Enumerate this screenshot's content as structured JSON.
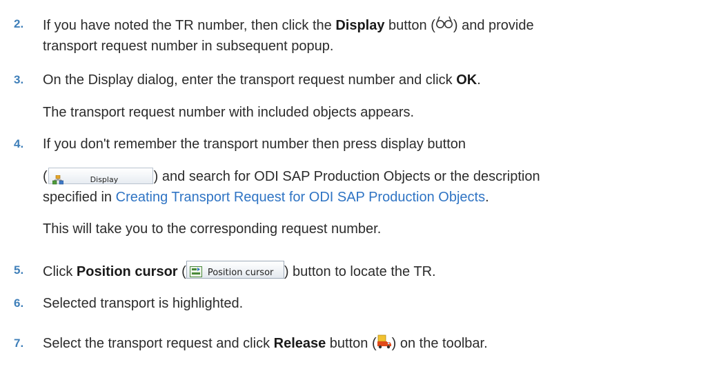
{
  "steps": {
    "s2": {
      "num": "2.",
      "pre": "If you have noted the TR number, then click the ",
      "bold": "Display",
      "mid": " button (",
      "post": ") and provide",
      "line2": "transport request number in subsequent popup."
    },
    "s3": {
      "num": "3.",
      "pre": "On the Display dialog, enter the transport request number and click ",
      "bold": "OK",
      "post": ".",
      "para": "The transport request number with included objects appears."
    },
    "s4": {
      "num": "4.",
      "line1": "If you don't remember the transport number then press display button",
      "open": "(",
      "button_label": "Display",
      "post": ") and search for ODI SAP Production Objects or the description",
      "pre3": "specified in ",
      "link": "Creating Transport Request for ODI SAP Production Objects",
      "post3": ".",
      "para": "This will take you to the corresponding request number."
    },
    "s5": {
      "num": "5.",
      "pre": "Click ",
      "bold": "Position cursor",
      "mid": " (",
      "button_label": "Position cursor",
      "post": ") button to locate the TR."
    },
    "s6": {
      "num": "6.",
      "text": "Selected transport is highlighted."
    },
    "s7": {
      "num": "7.",
      "pre": "Select the transport request and click ",
      "bold": "Release",
      "mid": " button (",
      "post": ") on the toolbar."
    }
  },
  "colors": {
    "step_number": "#3f7fb9",
    "link": "#2f74c4",
    "text": "#2b2b2b"
  },
  "icons": {
    "display": "glasses-icon",
    "display_button": "hierarchy-icon",
    "position_cursor": "position-cursor-icon",
    "release": "truck-release-icon"
  }
}
